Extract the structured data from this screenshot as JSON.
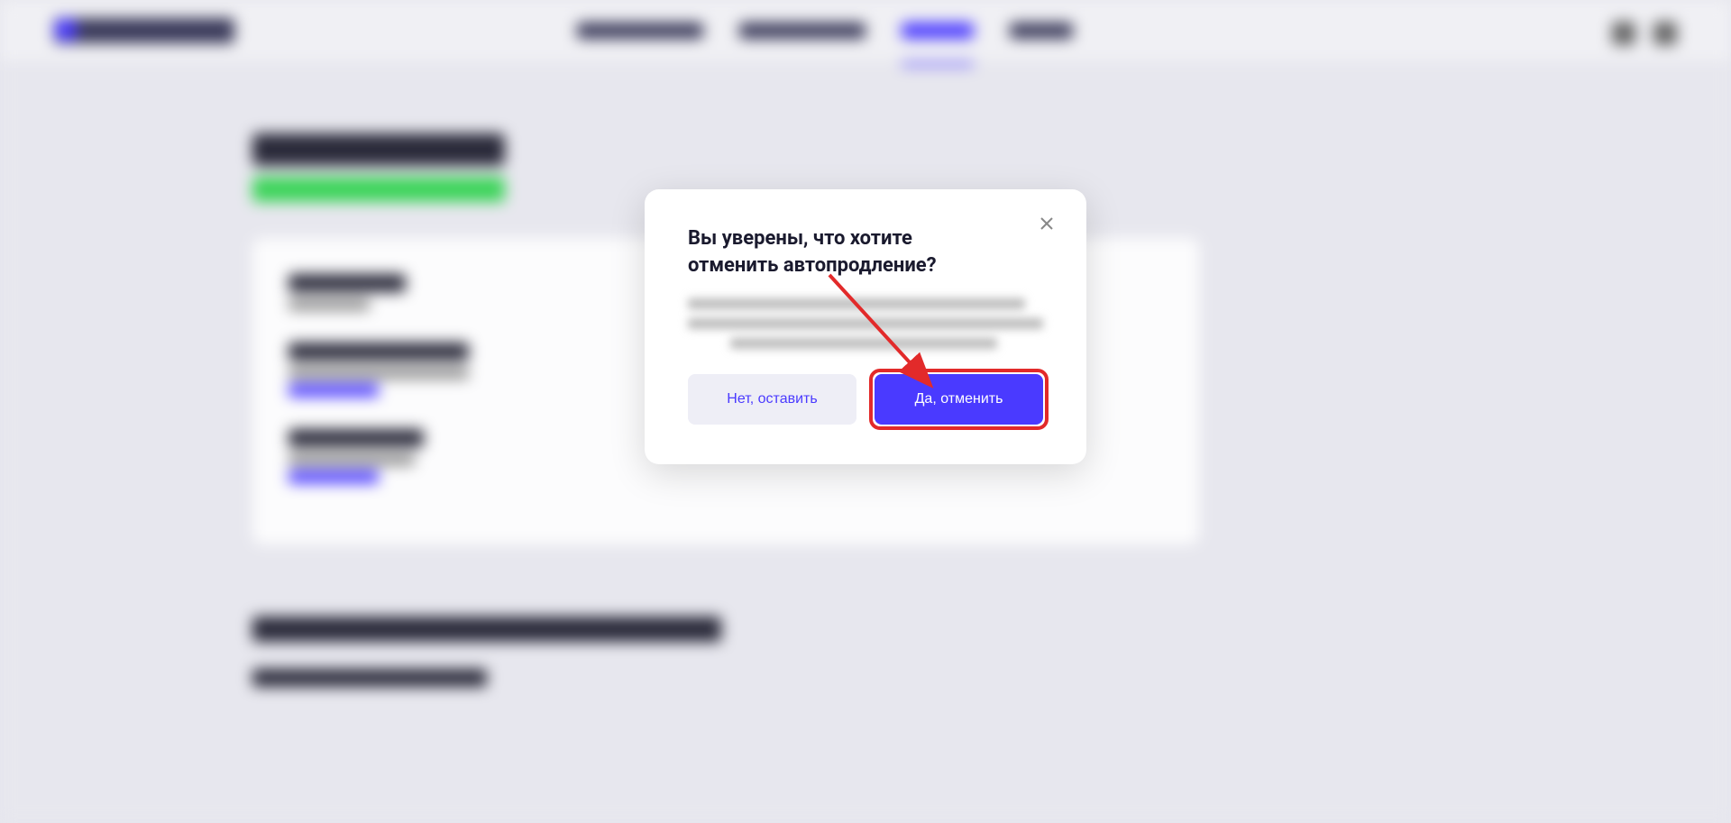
{
  "modal": {
    "title": "Вы уверены, что хотите отменить автопродление?",
    "cancel_label": "Нет, оставить",
    "confirm_label": "Да, отменить"
  }
}
